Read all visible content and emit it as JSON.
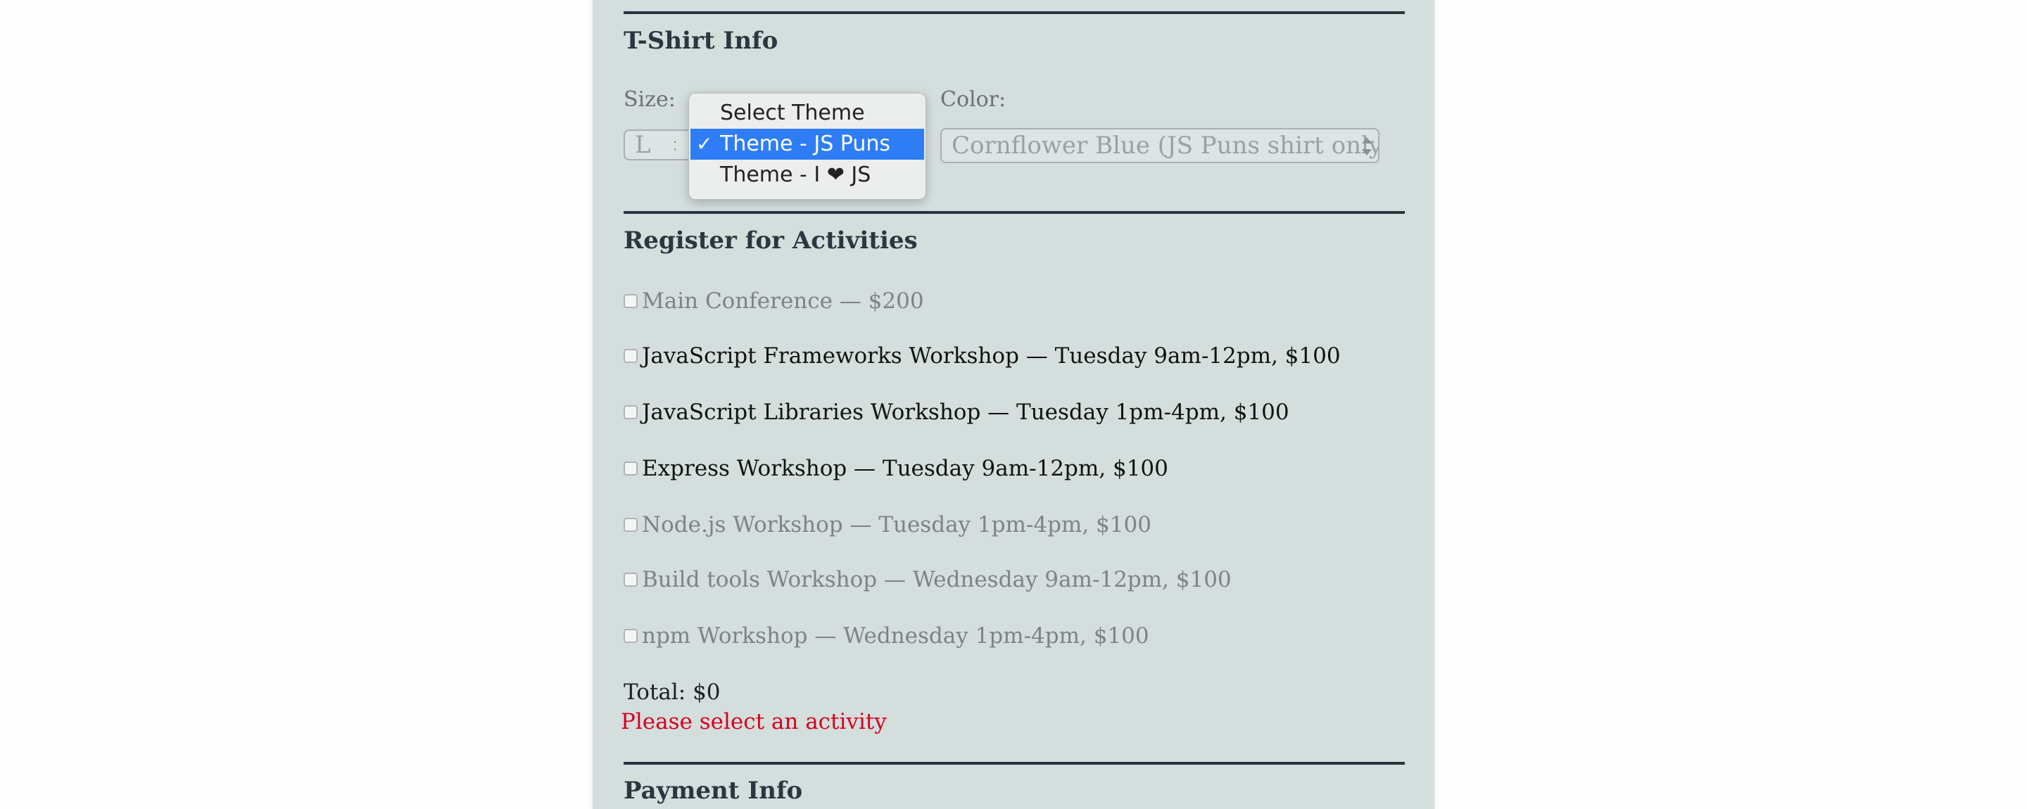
{
  "tshirt": {
    "title": "T-Shirt Info",
    "size_label": "Size:",
    "size_value": "L",
    "color_label": "Color:",
    "color_value": "Cornflower Blue (JS Puns shirt only)",
    "design_options": [
      {
        "label": "Select Theme",
        "selected": false
      },
      {
        "label": "Theme - JS Puns",
        "selected": true
      },
      {
        "label": "Theme - I ❤ JS",
        "selected": false
      }
    ],
    "check_glyph": "✓"
  },
  "activities": {
    "title": "Register for Activities",
    "items": [
      {
        "label": "Main Conference — $200",
        "disabled": true
      },
      {
        "label": "JavaScript Frameworks Workshop — Tuesday 9am-12pm, $100",
        "disabled": false
      },
      {
        "label": "JavaScript Libraries Workshop — Tuesday 1pm-4pm, $100",
        "disabled": false
      },
      {
        "label": "Express Workshop — Tuesday 9am-12pm, $100",
        "disabled": false
      },
      {
        "label": "Node.js Workshop — Tuesday 1pm-4pm, $100",
        "disabled": true
      },
      {
        "label": "Build tools Workshop — Wednesday 9am-12pm, $100",
        "disabled": true
      },
      {
        "label": "npm Workshop — Wednesday 1pm-4pm, $100",
        "disabled": true
      }
    ],
    "total": "Total: $0",
    "error": "Please select an activity"
  },
  "payment": {
    "title": "Payment Info"
  },
  "colors": {
    "panel_bg": "#d3dedd",
    "rule": "#26343e",
    "selected_option": "#2f7df6",
    "error": "#d8001c"
  }
}
